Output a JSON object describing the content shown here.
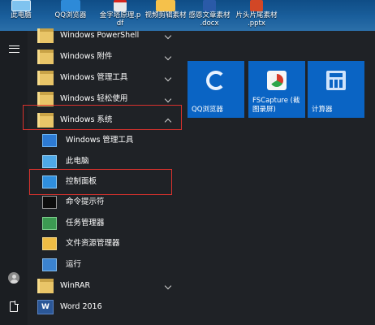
{
  "desktop": {
    "icons": [
      {
        "label": "此电脑",
        "icon": "computer-icon"
      },
      {
        "label": "QQ浏览器",
        "icon": "qq-browser-icon"
      },
      {
        "label": "金字塔原理.p\ndf",
        "icon": "pdf-icon"
      },
      {
        "label": "视频剪辑素材",
        "icon": "folder-icon"
      },
      {
        "label": "感恩文章素材\n.docx",
        "icon": "word-document-icon"
      },
      {
        "label": "片头片尾素材\n.pptx",
        "icon": "powerpoint-icon"
      }
    ]
  },
  "start_menu": {
    "app_list": [
      {
        "label": "Windows PowerShell",
        "icon": "folder-icon",
        "expandable": true
      },
      {
        "label": "Windows 附件",
        "icon": "folder-icon",
        "expandable": true
      },
      {
        "label": "Windows 管理工具",
        "icon": "folder-icon",
        "expandable": true
      },
      {
        "label": "Windows 轻松使用",
        "icon": "folder-icon",
        "expandable": true
      },
      {
        "label": "Windows 系统",
        "icon": "folder-icon",
        "expanded": true
      },
      {
        "label": "Windows 管理工具",
        "icon": "admin-tools-icon",
        "child": true
      },
      {
        "label": "此电脑",
        "icon": "computer-icon",
        "child": true
      },
      {
        "label": "控制面板",
        "icon": "control-panel-icon",
        "child": true
      },
      {
        "label": "命令提示符",
        "icon": "command-prompt-icon",
        "child": true
      },
      {
        "label": "任务管理器",
        "icon": "task-manager-icon",
        "child": true
      },
      {
        "label": "文件资源管理器",
        "icon": "file-explorer-icon",
        "child": true
      },
      {
        "label": "运行",
        "icon": "run-icon",
        "child": true
      },
      {
        "label": "WinRAR",
        "icon": "folder-icon",
        "expandable": true
      },
      {
        "label": "Word 2016",
        "icon": "word-icon"
      }
    ],
    "word_icon_letter": "W",
    "tiles": [
      {
        "label": "QQ浏览器",
        "icon": "qq-browser-icon"
      },
      {
        "label": "FSCapture (截\n图录屏)",
        "icon": "fscapture-icon"
      },
      {
        "label": "计算器",
        "icon": "calculator-icon"
      }
    ],
    "colors": {
      "tile_blue": "#0a64c4",
      "highlight_red": "#d8322d",
      "menu_background": "#1f2226"
    }
  }
}
